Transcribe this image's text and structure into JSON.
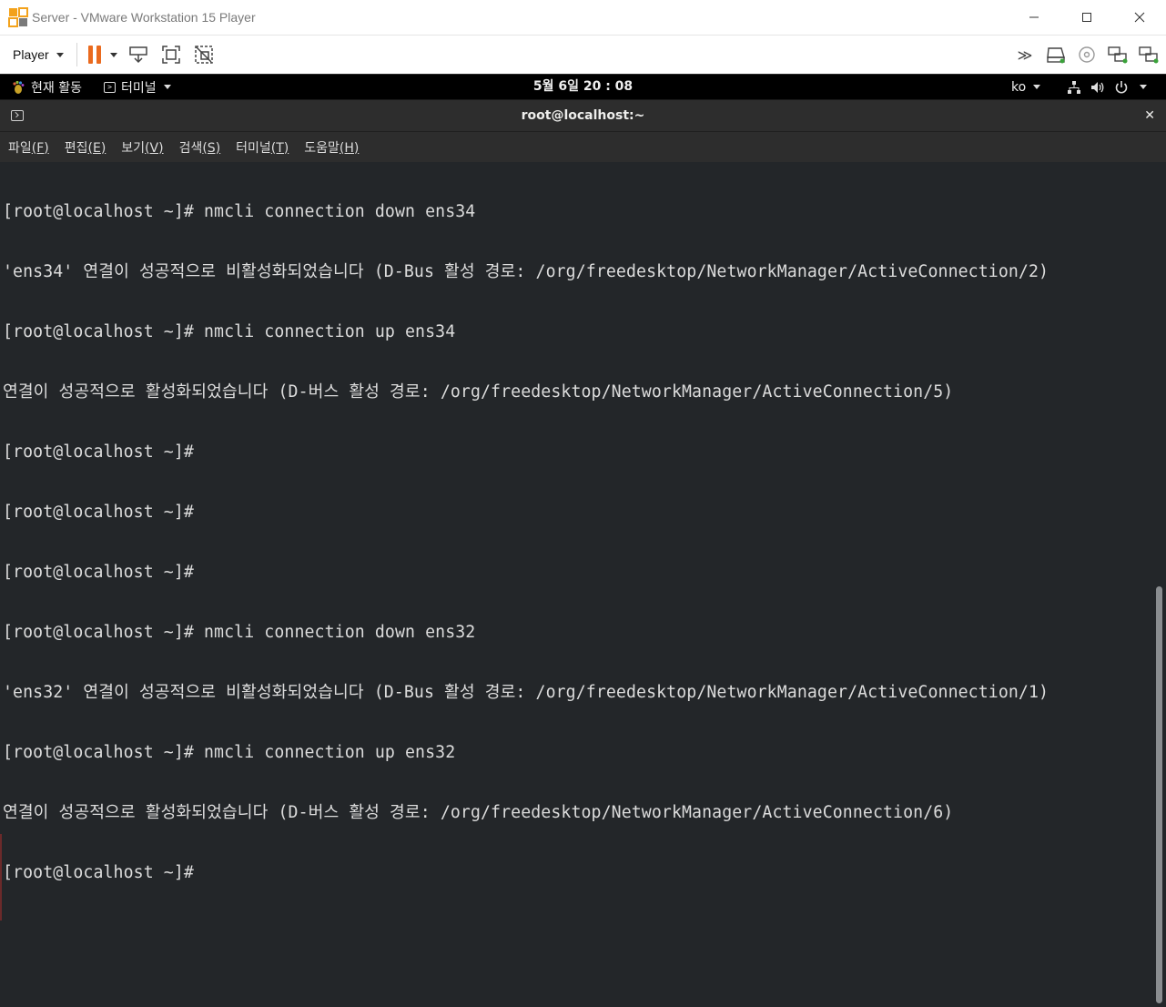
{
  "window": {
    "title": "Server - VMware Workstation 15 Player",
    "minimize": "—",
    "maximize": "☐",
    "close": "✕"
  },
  "toolbar": {
    "player_label": "Player",
    "icons": [
      "pause-icon",
      "send-ctrl-alt-del-icon",
      "full-screen-icon",
      "unity-icon",
      "more-devices-icon",
      "hard-disk-icon",
      "cd-dvd-icon",
      "network-adapter-icon",
      "network-adapter-2-icon"
    ],
    "more_label": "≫"
  },
  "gnome": {
    "activities_label": "현재 활동",
    "app_menu_label": "터미널",
    "clock": "5월 6일  20 : 08",
    "input_method": "ko"
  },
  "terminal": {
    "title": "root@localhost:~",
    "close_label": "✕",
    "menu": [
      {
        "label": "파일",
        "key": "(F)"
      },
      {
        "label": "편집",
        "key": "(E)"
      },
      {
        "label": "보기",
        "key": "(V)"
      },
      {
        "label": "검색",
        "key": "(S)"
      },
      {
        "label": "터미널",
        "key": "(T)"
      },
      {
        "label": "도움말",
        "key": "(H)"
      }
    ],
    "lines": [
      "[root@localhost ~]# nmcli connection down ens34",
      "'ens34' 연결이 성공적으로 비활성화되었습니다 (D-Bus 활성 경로: /org/freedesktop/NetworkManager/ActiveConnection/2)",
      "[root@localhost ~]# nmcli connection up ens34",
      "연결이 성공적으로 활성화되었습니다 (D-버스 활성 경로: /org/freedesktop/NetworkManager/ActiveConnection/5)",
      "[root@localhost ~]#",
      "[root@localhost ~]#",
      "[root@localhost ~]#",
      "[root@localhost ~]# nmcli connection down ens32",
      "'ens32' 연결이 성공적으로 비활성화되었습니다 (D-Bus 활성 경로: /org/freedesktop/NetworkManager/ActiveConnection/1)",
      "[root@localhost ~]# nmcli connection up ens32",
      "연결이 성공적으로 활성화되었습니다 (D-버스 활성 경로: /org/freedesktop/NetworkManager/ActiveConnection/6)",
      "[root@localhost ~]# "
    ]
  },
  "colors": {
    "terminal_bg": "#232629",
    "terminal_fg": "#dcdcdc",
    "accent_pause": "#ea6a1e",
    "gnome_bar": "#000000"
  }
}
